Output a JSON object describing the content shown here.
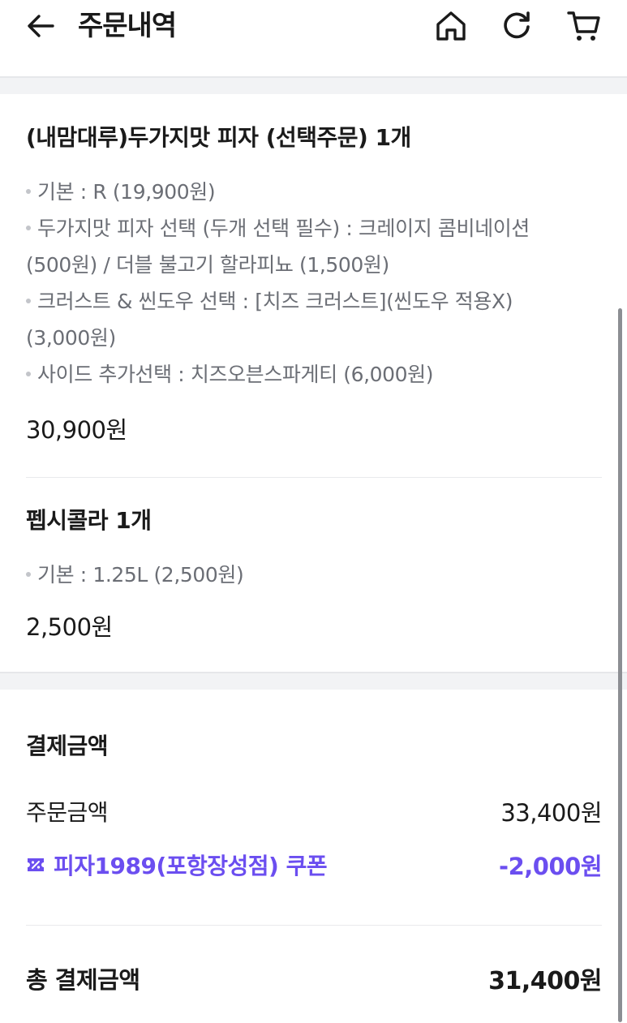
{
  "header": {
    "title": "주문내역",
    "icons": [
      "arrow-left-icon",
      "home-icon",
      "refresh-icon",
      "cart-icon"
    ]
  },
  "items": [
    {
      "title": "(내맘대루)두가지맛 피자 (선택주문) 1개",
      "options": [
        "기본 : R (19,900원)",
        "두가지맛 피자 선택 (두개 선택 필수) : 크레이지 콤비네이션",
        "(500원) / 더블 불고기 할라피뇨 (1,500원)",
        "크러스트 & 씬도우 선택 : [치즈 크러스트](씬도우 적용X)",
        "(3,000원)",
        "사이드 추가선택 : 치즈오븐스파게티 (6,000원)"
      ],
      "price": "30,900원"
    },
    {
      "title": "펩시콜라 1개",
      "options": [
        "기본 : 1.25L (2,500원)"
      ],
      "price": "2,500원"
    }
  ],
  "payment": {
    "title": "결제금액",
    "order_amount_label": "주문금액",
    "order_amount_value": "33,400원",
    "coupon_label": "피자1989(포항장성점) 쿠폰",
    "coupon_value": "-2,000원",
    "total_label": "총 결제금액",
    "total_value": "31,400원"
  },
  "colors": {
    "accent": "#6b4ef0",
    "muted_text": "#6b6e75",
    "band": "#f2f3f5"
  }
}
